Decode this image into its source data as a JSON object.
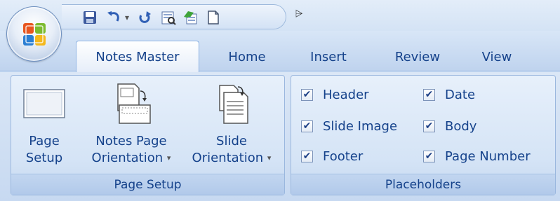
{
  "quick_access": {
    "buttons": [
      {
        "name": "save",
        "icon": "save-icon"
      },
      {
        "name": "undo",
        "icon": "undo-icon"
      },
      {
        "name": "undo-dropdown",
        "icon": "dropdown-arrow-icon"
      },
      {
        "name": "redo",
        "icon": "redo-icon"
      },
      {
        "name": "print-preview",
        "icon": "print-preview-icon"
      },
      {
        "name": "spelling",
        "icon": "spelling-icon"
      },
      {
        "name": "new",
        "icon": "new-document-icon"
      }
    ],
    "customize_glyph": "⩥"
  },
  "tabs": [
    {
      "label": "Notes Master",
      "active": true
    },
    {
      "label": "Home",
      "active": false
    },
    {
      "label": "Insert",
      "active": false
    },
    {
      "label": "Review",
      "active": false
    },
    {
      "label": "View",
      "active": false
    }
  ],
  "groups": {
    "page_setup": {
      "label": "Page Setup",
      "buttons": [
        {
          "line1": "Page",
          "line2": "Setup",
          "icon": "page-setup-icon",
          "has_dropdown": false
        },
        {
          "line1": "Notes Page",
          "line2": "Orientation",
          "icon": "notes-page-orientation-icon",
          "has_dropdown": true
        },
        {
          "line1": "Slide",
          "line2": "Orientation",
          "icon": "slide-orientation-icon",
          "has_dropdown": true
        }
      ]
    },
    "placeholders": {
      "label": "Placeholders",
      "checkboxes": [
        {
          "label": "Header",
          "checked": true
        },
        {
          "label": "Slide Image",
          "checked": true
        },
        {
          "label": "Footer",
          "checked": true
        },
        {
          "label": "Date",
          "checked": true
        },
        {
          "label": "Body",
          "checked": true
        },
        {
          "label": "Page Number",
          "checked": true
        }
      ]
    }
  },
  "glyphs": {
    "check": "✔",
    "dropdown": "▾"
  },
  "colors": {
    "text": "#15428b",
    "ribbon_bg": "#c9daf0",
    "group_border": "#9ab7de"
  }
}
